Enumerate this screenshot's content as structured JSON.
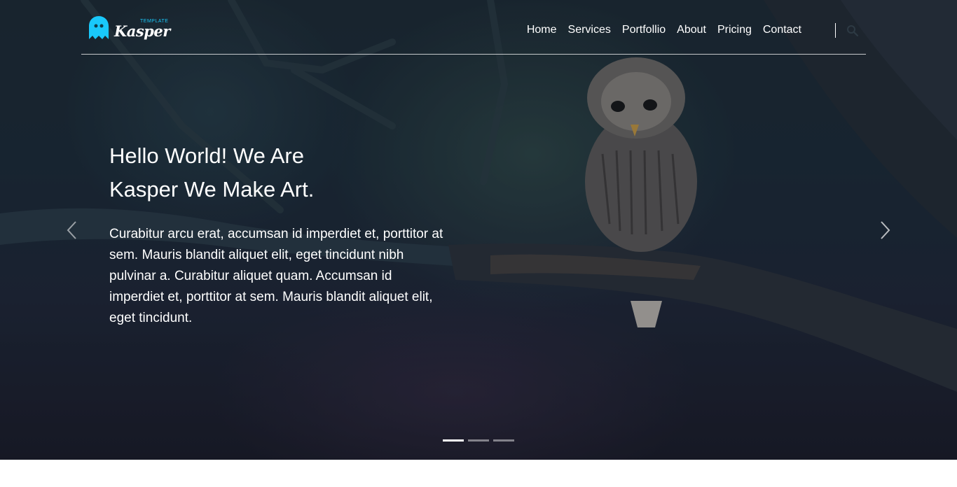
{
  "brand": {
    "name": "Kasper",
    "tag": "TEMPLATE",
    "accent_color": "#19c8fa",
    "logo_icon": "ghost-icon"
  },
  "nav": {
    "items": [
      {
        "label": "Home"
      },
      {
        "label": "Services"
      },
      {
        "label": "Portfollio"
      },
      {
        "label": "About"
      },
      {
        "label": "Pricing"
      },
      {
        "label": "Contact"
      }
    ],
    "search_icon": "search-icon"
  },
  "hero": {
    "title_line1": "Hello World! We Are",
    "title_line2": "Kasper We Make Art.",
    "description": "Curabitur arcu erat, accumsan id imperdiet et, porttitor at sem. Mauris blandit aliquet elit, eget tincidunt nibh pulvinar a. Curabitur aliquet quam. Accumsan id imperdiet et, porttitor at sem. Mauris blandit aliquet elit, eget tincidunt.",
    "prev_icon": "chevron-left-icon",
    "next_icon": "chevron-right-icon",
    "slides": {
      "count": 3,
      "active_index": 0
    }
  }
}
